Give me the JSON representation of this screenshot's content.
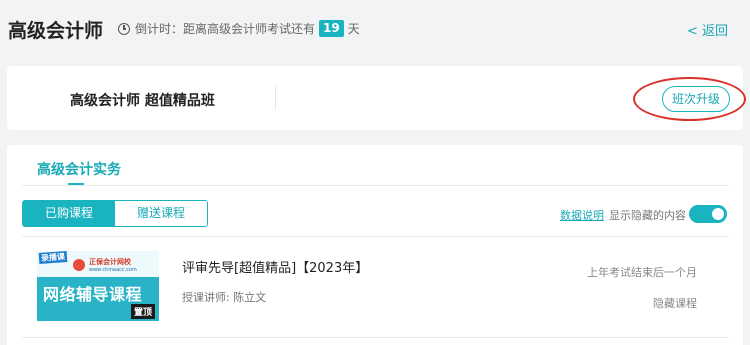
{
  "header": {
    "title": "高级会计师",
    "countdown_prefix": "倒计时：距离高级会计师考试还有",
    "countdown_days": "19",
    "countdown_unit": "天",
    "back_label": "< 返回"
  },
  "class_card": {
    "name": "高级会计师 超值精品班",
    "upgrade_label": "班次升级"
  },
  "subject_tab": "高级会计实务",
  "course_tabs": [
    {
      "label": "已购课程",
      "active": true
    },
    {
      "label": "赠送课程",
      "active": false
    }
  ],
  "controls": {
    "data_help": "数据说明",
    "show_hidden": "显示隐藏的内容",
    "show_hidden_on": true
  },
  "courses": [
    {
      "thumbnail": {
        "tag": "录播课",
        "school": "正保会计网校",
        "url": "www.chinaacc.com",
        "main_text": "网络辅导课程",
        "pin": "置顶"
      },
      "title": "评审先导[超值精品]【2023年】",
      "teacher": "授课讲师:   陈立文",
      "expire": "上年考试结束后一个月",
      "hide_label": "隐藏课程"
    }
  ],
  "colors": {
    "accent": "#1ab3c0",
    "annotation": "#d9312b"
  }
}
